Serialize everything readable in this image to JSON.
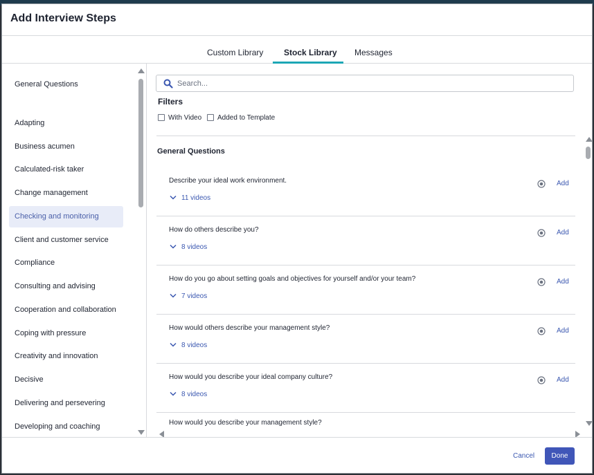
{
  "modal": {
    "title": "Add Interview Steps"
  },
  "tabs": [
    {
      "label": "Custom Library"
    },
    {
      "label": "Stock Library",
      "active": true
    },
    {
      "label": "Messages"
    }
  ],
  "sidebar": {
    "items": [
      {
        "label": "General Questions"
      },
      {
        "label": "Adapting"
      },
      {
        "label": "Business acumen"
      },
      {
        "label": "Calculated-risk taker"
      },
      {
        "label": "Change management"
      },
      {
        "label": "Checking and monitoring",
        "active": true
      },
      {
        "label": "Client and customer service"
      },
      {
        "label": "Compliance"
      },
      {
        "label": "Consulting and advising"
      },
      {
        "label": "Cooperation and collaboration"
      },
      {
        "label": "Coping with pressure"
      },
      {
        "label": "Creativity and innovation"
      },
      {
        "label": "Decisive"
      },
      {
        "label": "Delivering and persevering"
      },
      {
        "label": "Developing and coaching"
      }
    ]
  },
  "search": {
    "placeholder": "Search..."
  },
  "filters": {
    "label": "Filters",
    "with_video": "With Video",
    "added_to_template": "Added to Template"
  },
  "section": {
    "title": "General Questions"
  },
  "questions": [
    {
      "text": "Describe your ideal work environment.",
      "videos": "11 videos",
      "add": "Add"
    },
    {
      "text": "How do others describe you?",
      "videos": "8 videos",
      "add": "Add"
    },
    {
      "text": "How do you go about setting goals and objectives for yourself and/or your team?",
      "videos": "7 videos",
      "add": "Add"
    },
    {
      "text": "How would others describe your management style?",
      "videos": "8 videos",
      "add": "Add"
    },
    {
      "text": "How would you describe your ideal company culture?",
      "videos": "8 videos",
      "add": "Add"
    },
    {
      "text": "How would you describe your management style?",
      "videos": "",
      "add": ""
    }
  ],
  "footer": {
    "cancel": "Cancel",
    "done": "Done"
  },
  "colors": {
    "accent": "#4056b8",
    "tab_underline": "#1ca7b5",
    "link": "#3a57b0",
    "active_bg": "#e8ecf8"
  }
}
